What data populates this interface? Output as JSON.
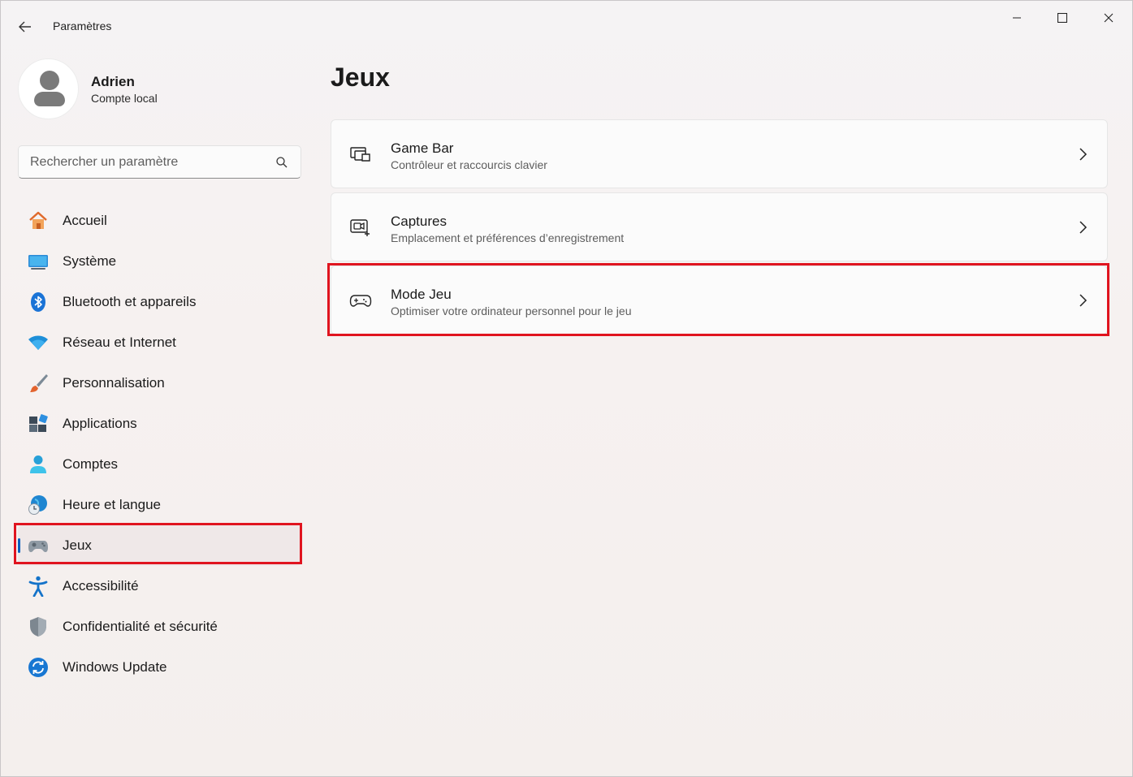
{
  "window": {
    "title": "Paramètres"
  },
  "profile": {
    "name": "Adrien",
    "account_type": "Compte local"
  },
  "search": {
    "placeholder": "Rechercher un paramètre"
  },
  "nav": {
    "items": [
      {
        "label": "Accueil",
        "icon": "home-icon"
      },
      {
        "label": "Système",
        "icon": "monitor-icon"
      },
      {
        "label": "Bluetooth et appareils",
        "icon": "bluetooth-icon"
      },
      {
        "label": "Réseau et Internet",
        "icon": "wifi-icon"
      },
      {
        "label": "Personnalisation",
        "icon": "paintbrush-icon"
      },
      {
        "label": "Applications",
        "icon": "apps-icon"
      },
      {
        "label": "Comptes",
        "icon": "person-icon"
      },
      {
        "label": "Heure et langue",
        "icon": "globe-clock-icon"
      },
      {
        "label": "Jeux",
        "icon": "gamepad-icon",
        "selected": true
      },
      {
        "label": "Accessibilité",
        "icon": "accessibility-icon"
      },
      {
        "label": "Confidentialité et sécurité",
        "icon": "shield-icon"
      },
      {
        "label": "Windows Update",
        "icon": "refresh-icon"
      }
    ]
  },
  "main": {
    "title": "Jeux",
    "cards": [
      {
        "title": "Game Bar",
        "subtitle": "Contrôleur et raccourcis clavier",
        "icon": "game-bar-icon"
      },
      {
        "title": "Captures",
        "subtitle": "Emplacement et préférences d’enregistrement",
        "icon": "capture-icon"
      },
      {
        "title": "Mode Jeu",
        "subtitle": "Optimiser votre ordinateur personnel pour le jeu",
        "icon": "gamepad-outline-icon",
        "highlighted": true
      }
    ]
  },
  "colors": {
    "accent": "#0a5fbf",
    "highlight": "#e0141f"
  }
}
